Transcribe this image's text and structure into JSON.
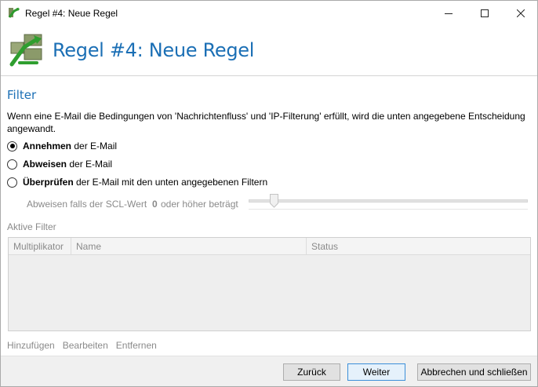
{
  "window": {
    "title": "Regel #4: Neue Regel",
    "controls": [
      "minimize-icon",
      "maximize-icon",
      "close-icon"
    ]
  },
  "header": {
    "heading": "Regel #4: Neue Regel"
  },
  "filter": {
    "section_title": "Filter",
    "description": "Wenn eine E-Mail die Bedingungen von 'Nachrichtenfluss' und 'IP-Filterung' erfüllt, wird die unten angegebene Entscheidung angewandt.",
    "options": [
      {
        "bold": "Annehmen",
        "rest": " der E-Mail",
        "checked": true
      },
      {
        "bold": "Abweisen",
        "rest": " der E-Mail",
        "checked": false
      },
      {
        "bold": "Überprüfen",
        "rest": " der E-Mail mit den unten angegebenen Filtern",
        "checked": false
      }
    ],
    "scl": {
      "label": "Abweisen falls der SCL-Wert",
      "value": "0",
      "suffix": "oder höher beträgt"
    }
  },
  "active_filters": {
    "label": "Aktive Filter",
    "columns": [
      "Multiplikator",
      "Name",
      "Status"
    ],
    "rows": []
  },
  "actions": {
    "add": "Hinzufügen",
    "edit": "Bearbeiten",
    "remove": "Entfernen"
  },
  "footer": {
    "back": "Zurück",
    "next": "Weiter",
    "cancel": "Abbrechen und schließen"
  },
  "colors": {
    "accent": "#1b6fb5",
    "disabled_text": "#8a8a8a",
    "primary_button_border": "#3c8fd9"
  }
}
